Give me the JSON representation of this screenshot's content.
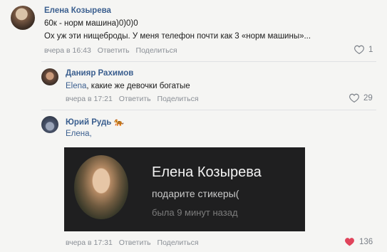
{
  "comments": [
    {
      "author": "Елена Козырева",
      "lines": [
        "60к - норм машина)0)0)0",
        "Ох уж эти нищеброды. У меня телефон почти как 3 «норм машины»..."
      ],
      "time": "вчера в 16:43",
      "reply": "Ответить",
      "share": "Поделиться",
      "likes": "1",
      "liked": false
    },
    {
      "author": "Данияр Рахимов",
      "mention": "Elena",
      "text": ", какие же девочки богатые",
      "time": "вчера в 17:21",
      "reply": "Ответить",
      "share": "Поделиться",
      "likes": "29",
      "liked": false
    },
    {
      "author": "Юрий Рудь",
      "author_badge": "🐅",
      "mention": "Елена,",
      "time": "вчера в 17:31",
      "reply": "Ответить",
      "share": "Поделиться",
      "likes": "136",
      "liked": true,
      "attachment": {
        "name": "Елена Козырева",
        "status": "подарите стикеры(",
        "seen": "была 9 минут назад"
      }
    }
  ],
  "colors": {
    "link": "#3b5f8f",
    "meta": "#8a8f96",
    "liked_heart": "#e0445b"
  }
}
